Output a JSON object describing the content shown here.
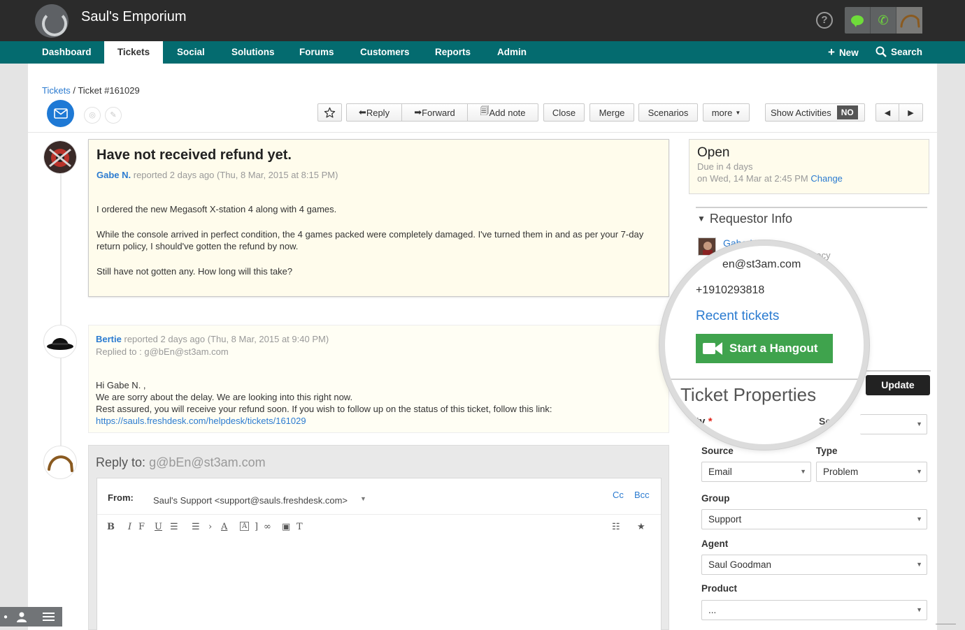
{
  "app": {
    "name": "Saul's Emporium"
  },
  "colors": {
    "topbar": "#2b2b2b",
    "navbar": "#046b6f",
    "link": "#2b7bd0",
    "hangout": "#3fa34d",
    "note_bg": "#fffcec"
  },
  "nav": {
    "items": [
      "Dashboard",
      "Tickets",
      "Social",
      "Solutions",
      "Forums",
      "Customers",
      "Reports",
      "Admin"
    ],
    "active": "Tickets",
    "new_label": "New",
    "search_label": "Search"
  },
  "breadcrumb": {
    "root": "Tickets",
    "sep": " / ",
    "current": "Ticket #161029"
  },
  "toolbar": {
    "reply": "Reply",
    "forward": "Forward",
    "add_note": "Add note",
    "close": "Close",
    "merge": "Merge",
    "scenarios": "Scenarios",
    "more": "more",
    "show_activities": "Show Activities",
    "show_activities_value": "NO"
  },
  "ticket": {
    "subject": "Have not received refund yet.",
    "requester": "Gabe N.",
    "reported_meta": "reported 2 days ago (Thu, 8 Mar, 2015 at 8:15 PM)",
    "body": [
      "I ordered the new Megasoft X-station 4 along with 4 games.",
      "While the console arrived in perfect condition, the 4 games packed were completely damaged. I've turned them in and as per your 7-day",
      "return policy, I should've gotten the refund by now.",
      "Still have not gotten any. How long will this take?"
    ]
  },
  "response": {
    "author": "Bertie",
    "reported_meta": "reported 2 days ago (Thu, 8 Mar, 2015 at 9:40 PM)",
    "replied_to": "Replied to : g@bEn@st3am.com",
    "lines": [
      "Hi Gabe N. ,",
      "We are sorry about the delay. We are looking into this right now.",
      "Rest assured, you will receive your refund soon. If you wish to follow up on the status of this ticket, follow this link:"
    ],
    "link": "https://sauls.freshdesk.com/helpdesk/tickets/161029"
  },
  "reply": {
    "label": "Reply to:",
    "to": "g@bEn@st3am.com",
    "from_label": "From:",
    "from_value": "Saul's Support <support@sauls.freshdesk.com>",
    "cc": "Cc",
    "bcc": "Bcc"
  },
  "status": {
    "state": "Open",
    "due": "Due in 4 days",
    "due_on": "on Wed, 14 Mar at 2:45 PM",
    "change": "Change"
  },
  "requestor": {
    "title": "Requestor Info",
    "name": "Gabe N.",
    "role_fragment_a": "M",
    "role_fragment_b": "er Advocacy",
    "email_fragment": "en@st3am.com",
    "phone": "+1910293818",
    "recent_tickets": "Recent tickets",
    "hangout": "Start a Hangout"
  },
  "properties": {
    "title": "Ticket Properties",
    "priority_fragment": "ity",
    "status_fragment": "S",
    "status_fragment_b": "en",
    "update": "Update",
    "source_label": "Source",
    "source_value": "Email",
    "type_label": "Type",
    "type_value": "Problem",
    "group_label": "Group",
    "group_value": "Support",
    "agent_label": "Agent",
    "agent_value": "Saul Goodman",
    "product_label": "Product",
    "product_value": "..."
  }
}
